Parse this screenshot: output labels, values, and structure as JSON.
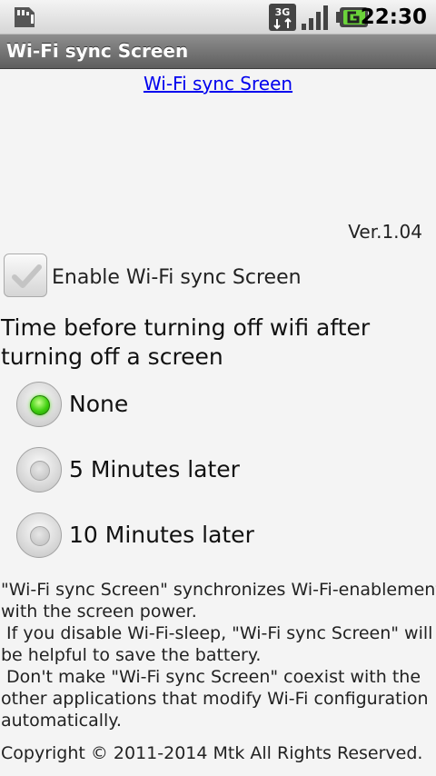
{
  "status_bar": {
    "time": "22:30",
    "network_type": "3G",
    "icons": [
      "sd-card-icon",
      "3g-data-icon",
      "signal-strength-icon",
      "battery-charging-icon"
    ]
  },
  "app": {
    "title": "Wi-Fi sync Screen",
    "link_text": "Wi-Fi sync Sreen",
    "version": "Ver.1.04"
  },
  "settings": {
    "enable_label": "Enable Wi-Fi sync Screen",
    "enable_checked": true,
    "question": "Time before turning off wifi after turning off a screen",
    "options": [
      {
        "label": "None",
        "selected": true
      },
      {
        "label": "5 Minutes later",
        "selected": false
      },
      {
        "label": "10 Minutes later",
        "selected": false
      }
    ]
  },
  "description": {
    "lines": [
      "\"Wi-Fi sync Screen\" synchronizes Wi-Fi-enablement",
      "with the screen power.",
      " If you disable Wi-Fi-sleep, \"Wi-Fi sync Screen\" will",
      "be helpful to save the battery.",
      " Don't make \"Wi-Fi sync Screen\" coexist with the",
      "other applications that modify Wi-Fi configuration",
      "automatically."
    ]
  },
  "footer": {
    "copyright": "Copyright © 2011-2014 Mtk All Rights Reserved."
  },
  "colors": {
    "link": "#0000ee",
    "radio_selected": "#3fd00f",
    "title_bar": "#6e6e6e",
    "background": "#f4f4f4"
  }
}
